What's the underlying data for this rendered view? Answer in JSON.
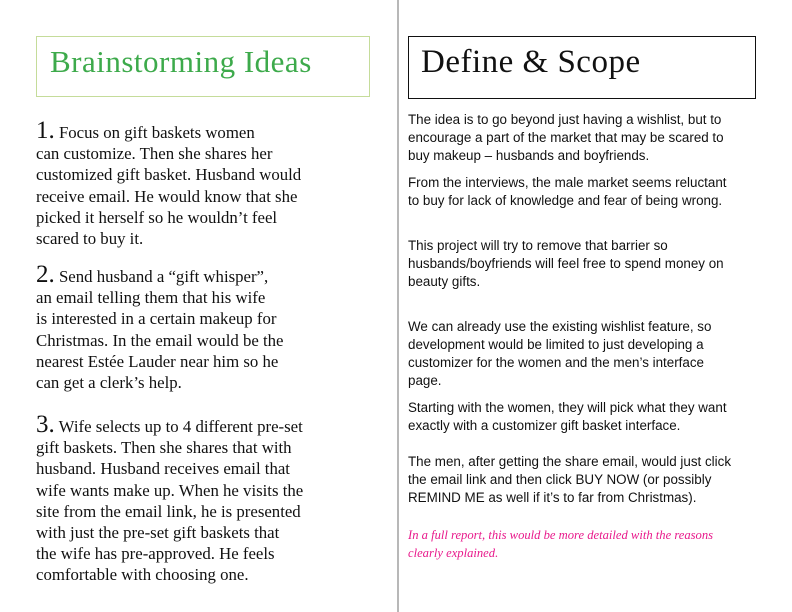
{
  "left": {
    "title": "Brainstorming Ideas",
    "ideas": [
      {
        "number": "1.",
        "lines": [
          "Focus on gift baskets women",
          "can customize. Then she shares her",
          "customized gift basket. Husband would",
          "receive email. He would know that she",
          "picked it herself so he wouldn’t feel",
          "scared to buy it."
        ]
      },
      {
        "number": "2.",
        "lines": [
          "Send husband a “gift whisper”,",
          "an email telling them that his wife",
          "is interested in a certain makeup for",
          "Christmas. In the email would be the",
          "nearest Estée Lauder near him so he",
          "can get a clerk’s help."
        ]
      },
      {
        "number": "3.",
        "lines": [
          "Wife selects up to 4 different pre-set",
          "gift baskets. Then she shares that with",
          "husband. Husband receives email that",
          "wife wants make up. When he visits the",
          "site from the email link, he is presented",
          "with just the pre-set gift baskets that",
          "the wife has pre-approved. He feels",
          "comfortable with choosing one."
        ]
      }
    ]
  },
  "right": {
    "title": "Define & Scope",
    "paragraphs": [
      [
        "The idea is to go beyond just having a wishlist, but to",
        "encourage a part of the market that may be scared to",
        "buy makeup – husbands and boyfriends."
      ],
      [
        "From the interviews, the male market seems reluctant",
        "to buy for lack of knowledge and fear of being wrong."
      ],
      [
        "This project will try to remove that barrier so",
        "husbands/boyfriends will feel free to spend money on",
        "beauty gifts."
      ],
      [
        "We can already use the existing wishlist feature, so",
        "development would be limited to just developing a",
        "customizer for the women and the men’s interface",
        "page."
      ],
      [
        "Starting with the women, they will pick what they want",
        "exactly with a customizer gift basket interface."
      ],
      [
        "The men, after getting the share email, would just click",
        "the email link and then click BUY NOW (or possibly",
        "REMIND ME as well if it’s to far from Christmas)."
      ]
    ],
    "note": [
      "In a full report, this would be more detailed with the reasons",
      "clearly explained."
    ]
  },
  "colors": {
    "title_green": "#3daa4b",
    "note_pink": "#e8198b"
  }
}
